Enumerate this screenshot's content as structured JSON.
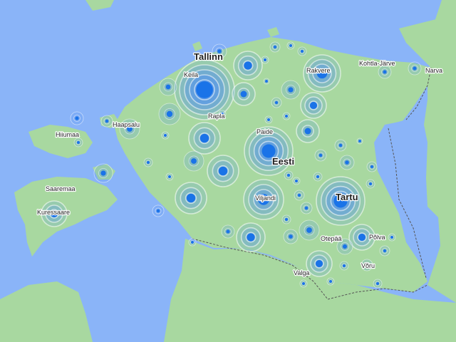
{
  "map": {
    "colors": {
      "water": "#8ab4f8",
      "land": "#a8d8a0",
      "land_light": "#c4e6bb",
      "land_dark": "#8fcb8a",
      "border": "#555555",
      "marker_core": "#1a73e8",
      "marker_ring": "#4f8ff0"
    },
    "labels": {
      "tallinn": "Tallinn",
      "keila": "Keila",
      "rapla": "Rapla",
      "haapsalu": "Haapsalu",
      "hiiumaa": "Hiiumaa",
      "saaremaa": "Saaremaa",
      "kuressaare": "Kuressaare",
      "paide": "Paide",
      "eesti": "Eesti",
      "rakvere": "Rakvere",
      "kohtla_jarve": "Kohtla-Järve",
      "narva": "Narva",
      "tartu": "Tartu",
      "viljandi": "Viljandi",
      "otepaa": "Otepää",
      "polva": "Põlva",
      "voru": "Võru",
      "valga": "Valga"
    },
    "markers": [
      {
        "name": "tallinn-marker",
        "size": "xl"
      },
      {
        "name": "eesti-marker",
        "size": "xl"
      },
      {
        "name": "tartu-marker",
        "size": "xl"
      },
      {
        "name": "viljandi-marker",
        "size": "lg"
      },
      {
        "name": "rakvere-marker",
        "size": "lg"
      }
    ]
  }
}
